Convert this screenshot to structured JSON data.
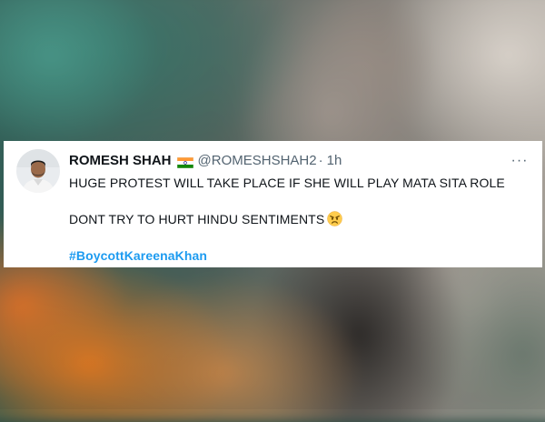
{
  "tweet": {
    "author": {
      "display_name": "ROMESH SHAH",
      "flag_icon": "india-flag-icon",
      "handle": "@ROMESHSHAH2",
      "separator": "·",
      "timestamp": "1h",
      "avatar_icon": "user-avatar-icon"
    },
    "more_icon": "more-options-icon",
    "more_label": "···",
    "lines": {
      "line1": "HUGE PROTEST WILL TAKE PLACE IF SHE WILL PLAY MATA SITA ROLE",
      "line2": "DONT TRY TO HURT HINDU SENTIMENTS",
      "line2_emoji": "angry-face-icon"
    },
    "hashtag": "#BoycottKareenaKhan"
  },
  "colors": {
    "text_primary": "#0f1419",
    "text_secondary": "#536471",
    "link": "#1d9bf0",
    "card_background": "#ffffff"
  }
}
